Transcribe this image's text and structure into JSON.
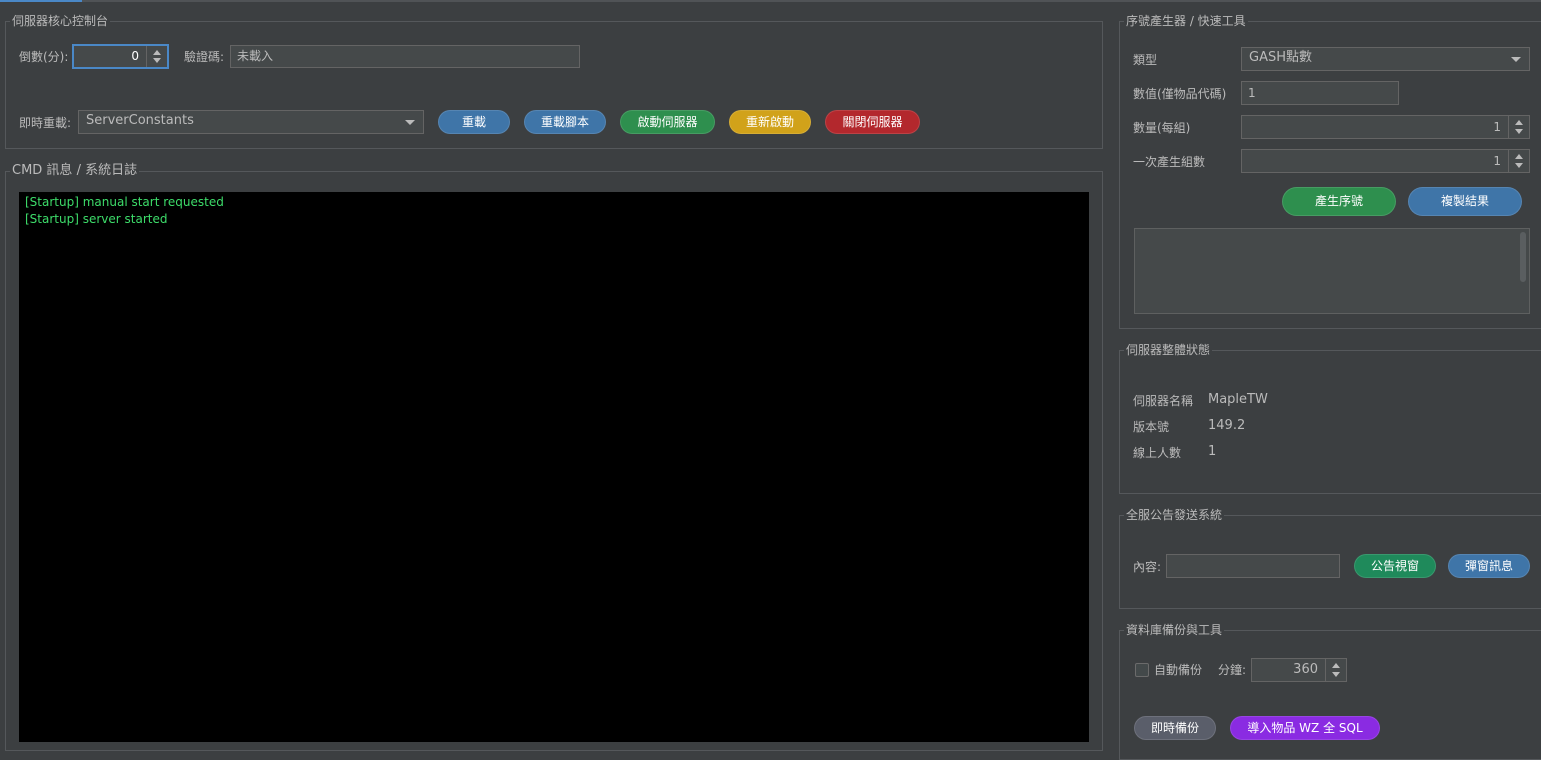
{
  "colors": {
    "background": "#3c3f41",
    "accent": "#4a88c7",
    "console_bg": "#000000",
    "console_text": "#3ddc6a",
    "btn_blue": "#3f75a8",
    "btn_green": "#2e8f4e",
    "btn_teal_green": "#1f8a5b",
    "btn_yellow": "#d1a21a",
    "btn_red": "#b3282d",
    "btn_purple": "#8a2be2",
    "btn_gray": "#5a5e6a"
  },
  "core": {
    "title": "伺服器核心控制台",
    "countdown_label": "倒數(分):",
    "countdown_value": "0",
    "verify_label": "驗證碼:",
    "verify_value": "未載入",
    "reload_label": "即時重載:",
    "reload_select": "ServerConstants",
    "buttons": {
      "reload": "重載",
      "reload_script": "重載腳本",
      "start_server": "啟動伺服器",
      "restart": "重新啟動",
      "stop_server": "關閉伺服器"
    }
  },
  "log": {
    "title": "CMD 訊息 / 系統日誌",
    "lines": [
      "[Startup] manual start requested",
      "[Startup] server started"
    ]
  },
  "serial": {
    "title": "序號產生器 / 快速工具",
    "type_label": "類型",
    "type_value": "GASH點數",
    "value_label": "數值(僅物品代碼)",
    "value_value": "1",
    "qty_label": "數量(每組)",
    "qty_value": "1",
    "groups_label": "一次產生組數",
    "groups_value": "1",
    "generate_button": "產生序號",
    "copy_button": "複製結果"
  },
  "status": {
    "title": "伺服器整體狀態",
    "name_label": "伺服器名稱",
    "name_value": "MapleTW",
    "version_label": "版本號",
    "version_value": "149.2",
    "online_label": "線上人數",
    "online_value": "1"
  },
  "announce": {
    "title": "全服公告發送系統",
    "content_label": "內容:",
    "content_value": "",
    "window_button": "公告視窗",
    "popup_button": "彈窗訊息"
  },
  "backup": {
    "title": "資料庫備份與工具",
    "auto_label": "自動備份",
    "auto_checked": false,
    "minutes_label": "分鐘:",
    "minutes_value": "360",
    "backup_now_button": "即時備份",
    "import_button": "導入物品 WZ 全 SQL"
  }
}
